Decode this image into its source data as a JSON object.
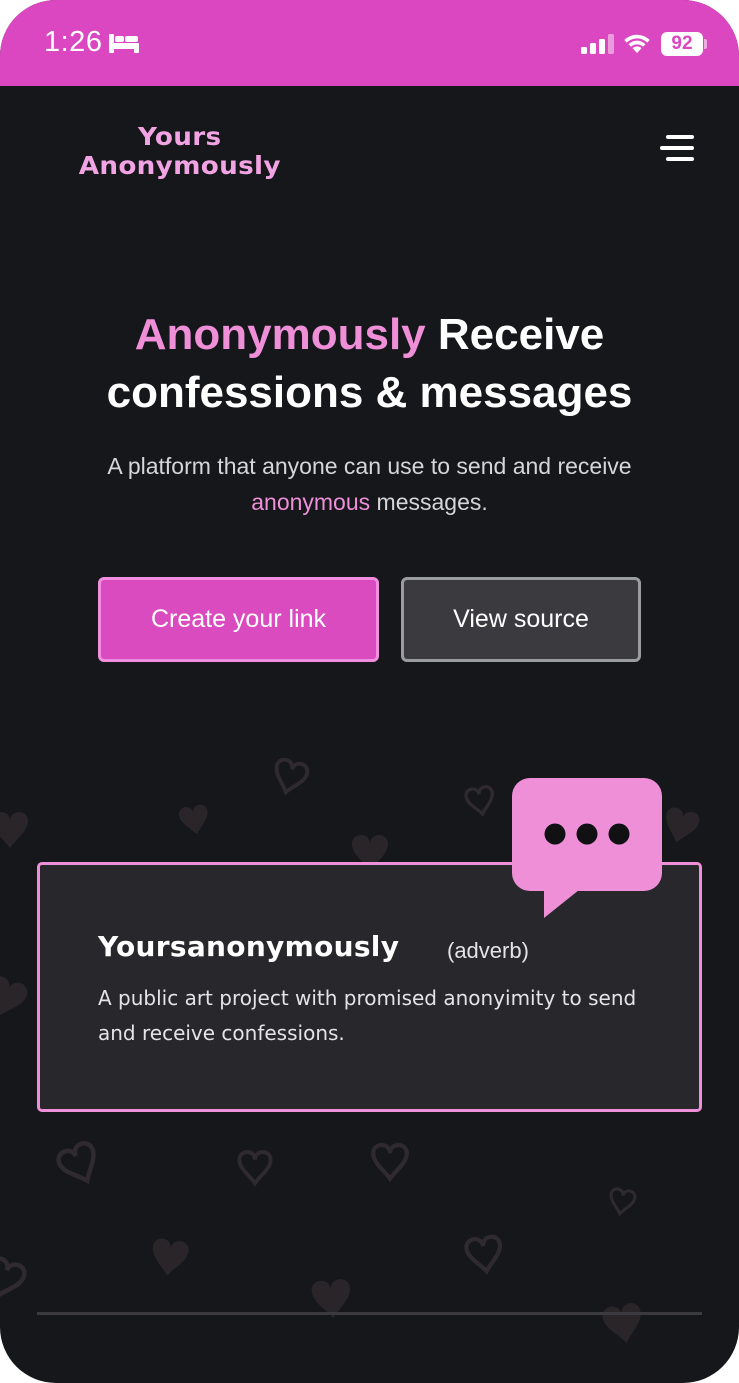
{
  "status_bar": {
    "time": "1:26",
    "battery": "92",
    "background": "#db47c0"
  },
  "header": {
    "logo_line1": "Yours",
    "logo_line2": "Anonymously",
    "menu_icon": "hamburger-menu-icon"
  },
  "hero": {
    "title_accent": "Anonymously",
    "title_rest_1": "Receive",
    "title_rest_2": "confessions & messages",
    "subtitle_part1": "A platform that anyone can use to send and receive",
    "subtitle_accent": "anonymous",
    "subtitle_part2": "messages."
  },
  "buttons": {
    "primary_label": "Create your link",
    "secondary_label": "View source"
  },
  "definition_card": {
    "word": "Yoursanonymously",
    "part_of_speech": "(adverb)",
    "definition": "A public art project with promised anonyimity to send and receive confessions.",
    "bubble_icon": "chat-bubble-icon"
  },
  "colors": {
    "accent_pink": "#ee8fd8",
    "button_pink": "#d94bbf",
    "background": "#16171b",
    "card_background": "#28272b"
  }
}
